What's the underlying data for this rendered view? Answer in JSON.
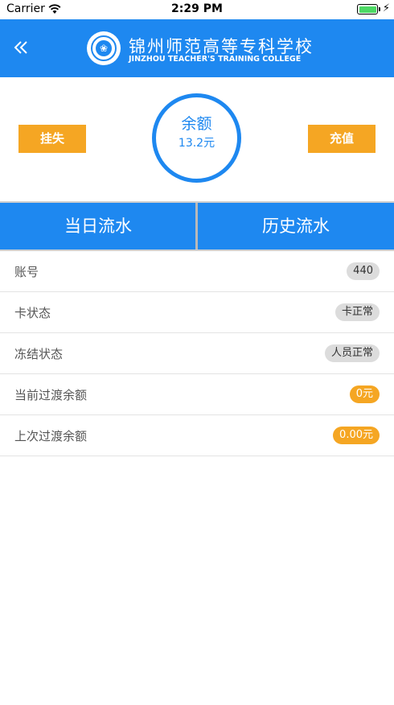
{
  "status_bar": {
    "carrier": "Carrier",
    "time": "2:29 PM"
  },
  "header": {
    "back_icon": "double-chevron-left-icon",
    "logo_icon": "college-emblem-icon",
    "title_cn": "锦州师范高等专科学校",
    "title_en": "JINZHOU TEACHER'S TRAINING COLLEGE"
  },
  "balance": {
    "label": "余额",
    "value": "13.2元"
  },
  "actions": {
    "report_loss": "挂失",
    "recharge": "充值"
  },
  "tabs": [
    {
      "label": "当日流水"
    },
    {
      "label": "历史流水"
    }
  ],
  "info": [
    {
      "label": "账号",
      "value": "440",
      "style": "gray"
    },
    {
      "label": "卡状态",
      "value": "卡正常",
      "style": "gray"
    },
    {
      "label": "冻结状态",
      "value": "人员正常",
      "style": "gray"
    },
    {
      "label": "当前过渡余额",
      "value": "0元",
      "style": "orange"
    },
    {
      "label": "上次过渡余额",
      "value": "0.00元",
      "style": "orange"
    }
  ],
  "colors": {
    "primary": "#1e88f0",
    "accent": "#f5a623",
    "badge_gray": "#dcdcdc"
  }
}
